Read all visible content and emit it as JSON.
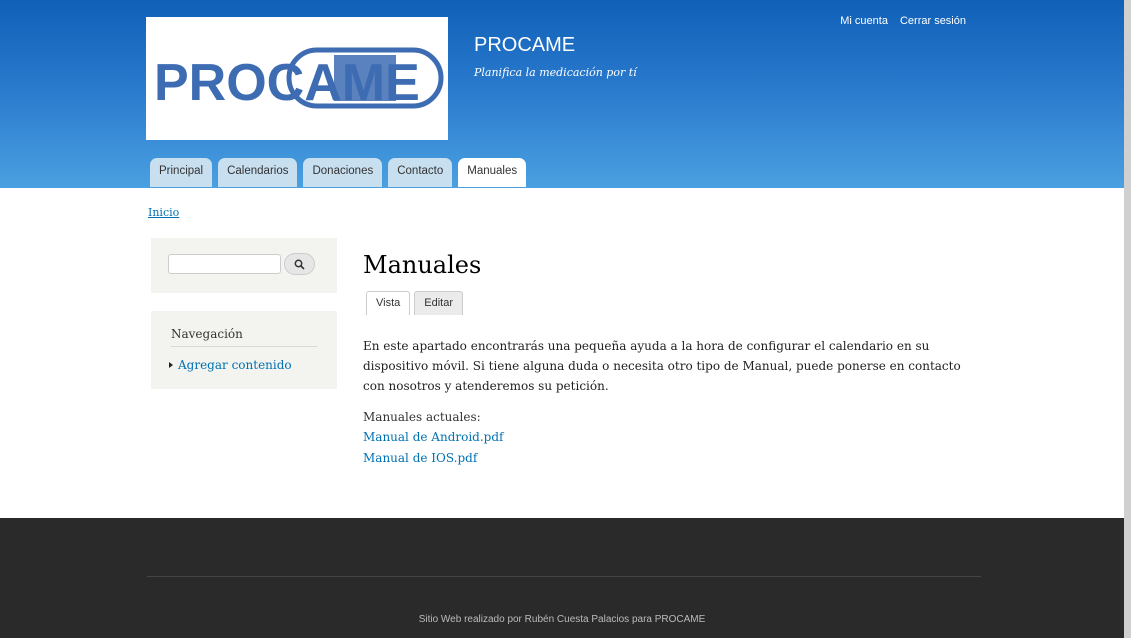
{
  "header": {
    "logo_text": "PROCAME",
    "site_name": "PROCAME",
    "slogan": "Planifica la medicación por tí",
    "secondary_menu": [
      "Mi cuenta",
      "Cerrar sesión"
    ],
    "main_menu": [
      {
        "label": "Principal",
        "active": false
      },
      {
        "label": "Calendarios",
        "active": false
      },
      {
        "label": "Donaciones",
        "active": false
      },
      {
        "label": "Contacto",
        "active": false
      },
      {
        "label": "Manuales",
        "active": true
      }
    ],
    "colors": {
      "header_top": "#1060b8",
      "header_bottom": "#4aa0e0",
      "logo_blue": "#3d6cb3"
    }
  },
  "breadcrumb": "Inicio",
  "sidebar": {
    "search": {
      "placeholder": "",
      "button_icon": "search-icon"
    },
    "navigation": {
      "title": "Navegación",
      "items": [
        "Agregar contenido"
      ]
    }
  },
  "main": {
    "title": "Manuales",
    "tabs": [
      {
        "label": "Vista",
        "active": true
      },
      {
        "label": "Editar",
        "active": false
      }
    ],
    "body": "En este apartado encontrarás una pequeña ayuda a la hora de configurar el calendario en su dispositivo móvil. Si tiene alguna duda o necesita otro tipo de Manual, puede ponerse en contacto con nosotros y atenderemos su petición.",
    "manuals_label": "Manuales actuales:",
    "manuals": [
      "Manual de Android.pdf",
      "Manual de IOS.pdf"
    ]
  },
  "footer": {
    "text": "Sitio Web realizado por Rubén Cuesta Palacios para PROCAME"
  }
}
